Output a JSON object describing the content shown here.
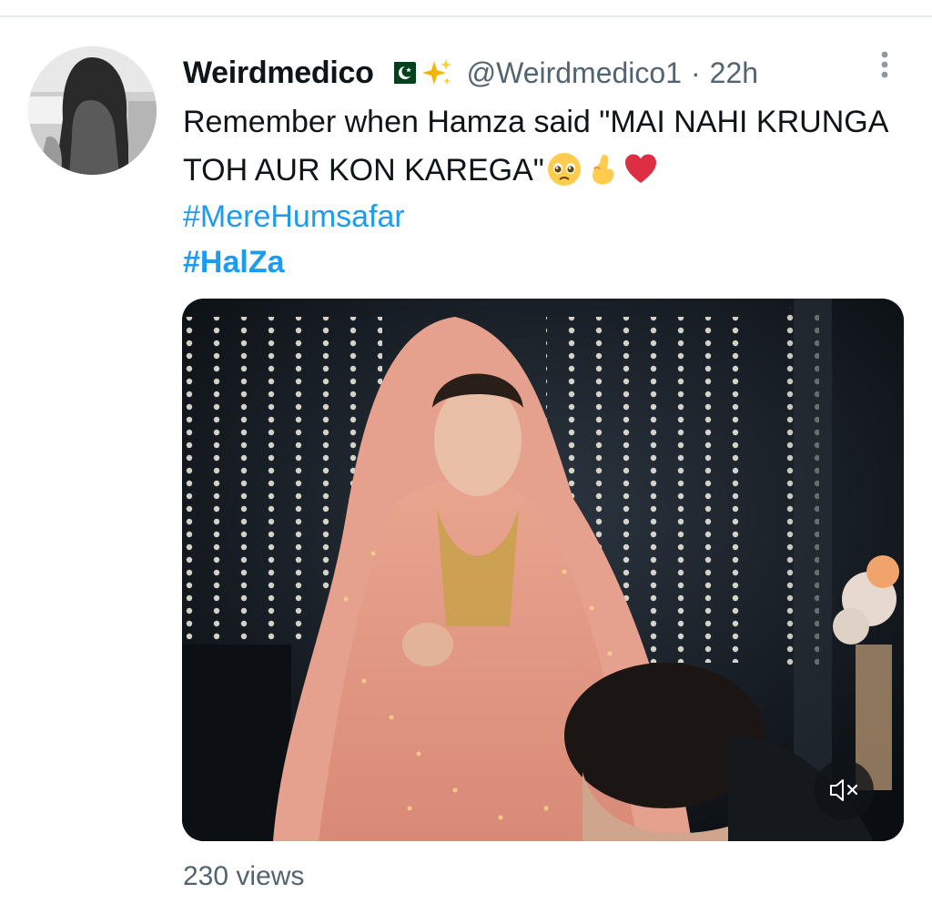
{
  "tweet": {
    "display_name": "Weirdmedico",
    "handle": "@Weirdmedico1",
    "separator": "·",
    "time": "22h",
    "text": "Remember when Hamza said \"MAI NAHI KRUNGA TOH AUR KON KAREGA\"",
    "hashtags": [
      "#MereHumsafar",
      "#HalZa"
    ],
    "views_count": "230",
    "views_label": "views"
  },
  "badges": [
    "pakistan-flag-icon",
    "sparkles-icon"
  ],
  "text_emojis": [
    "pleading-face-icon",
    "pinching-hand-icon",
    "red-heart-icon"
  ],
  "media": {
    "type": "video",
    "muted": true,
    "mute_icon": "speaker-muted-icon"
  },
  "colors": {
    "link": "#1d9bf0",
    "secondary_text": "#536471",
    "primary_text": "#0f1419"
  }
}
